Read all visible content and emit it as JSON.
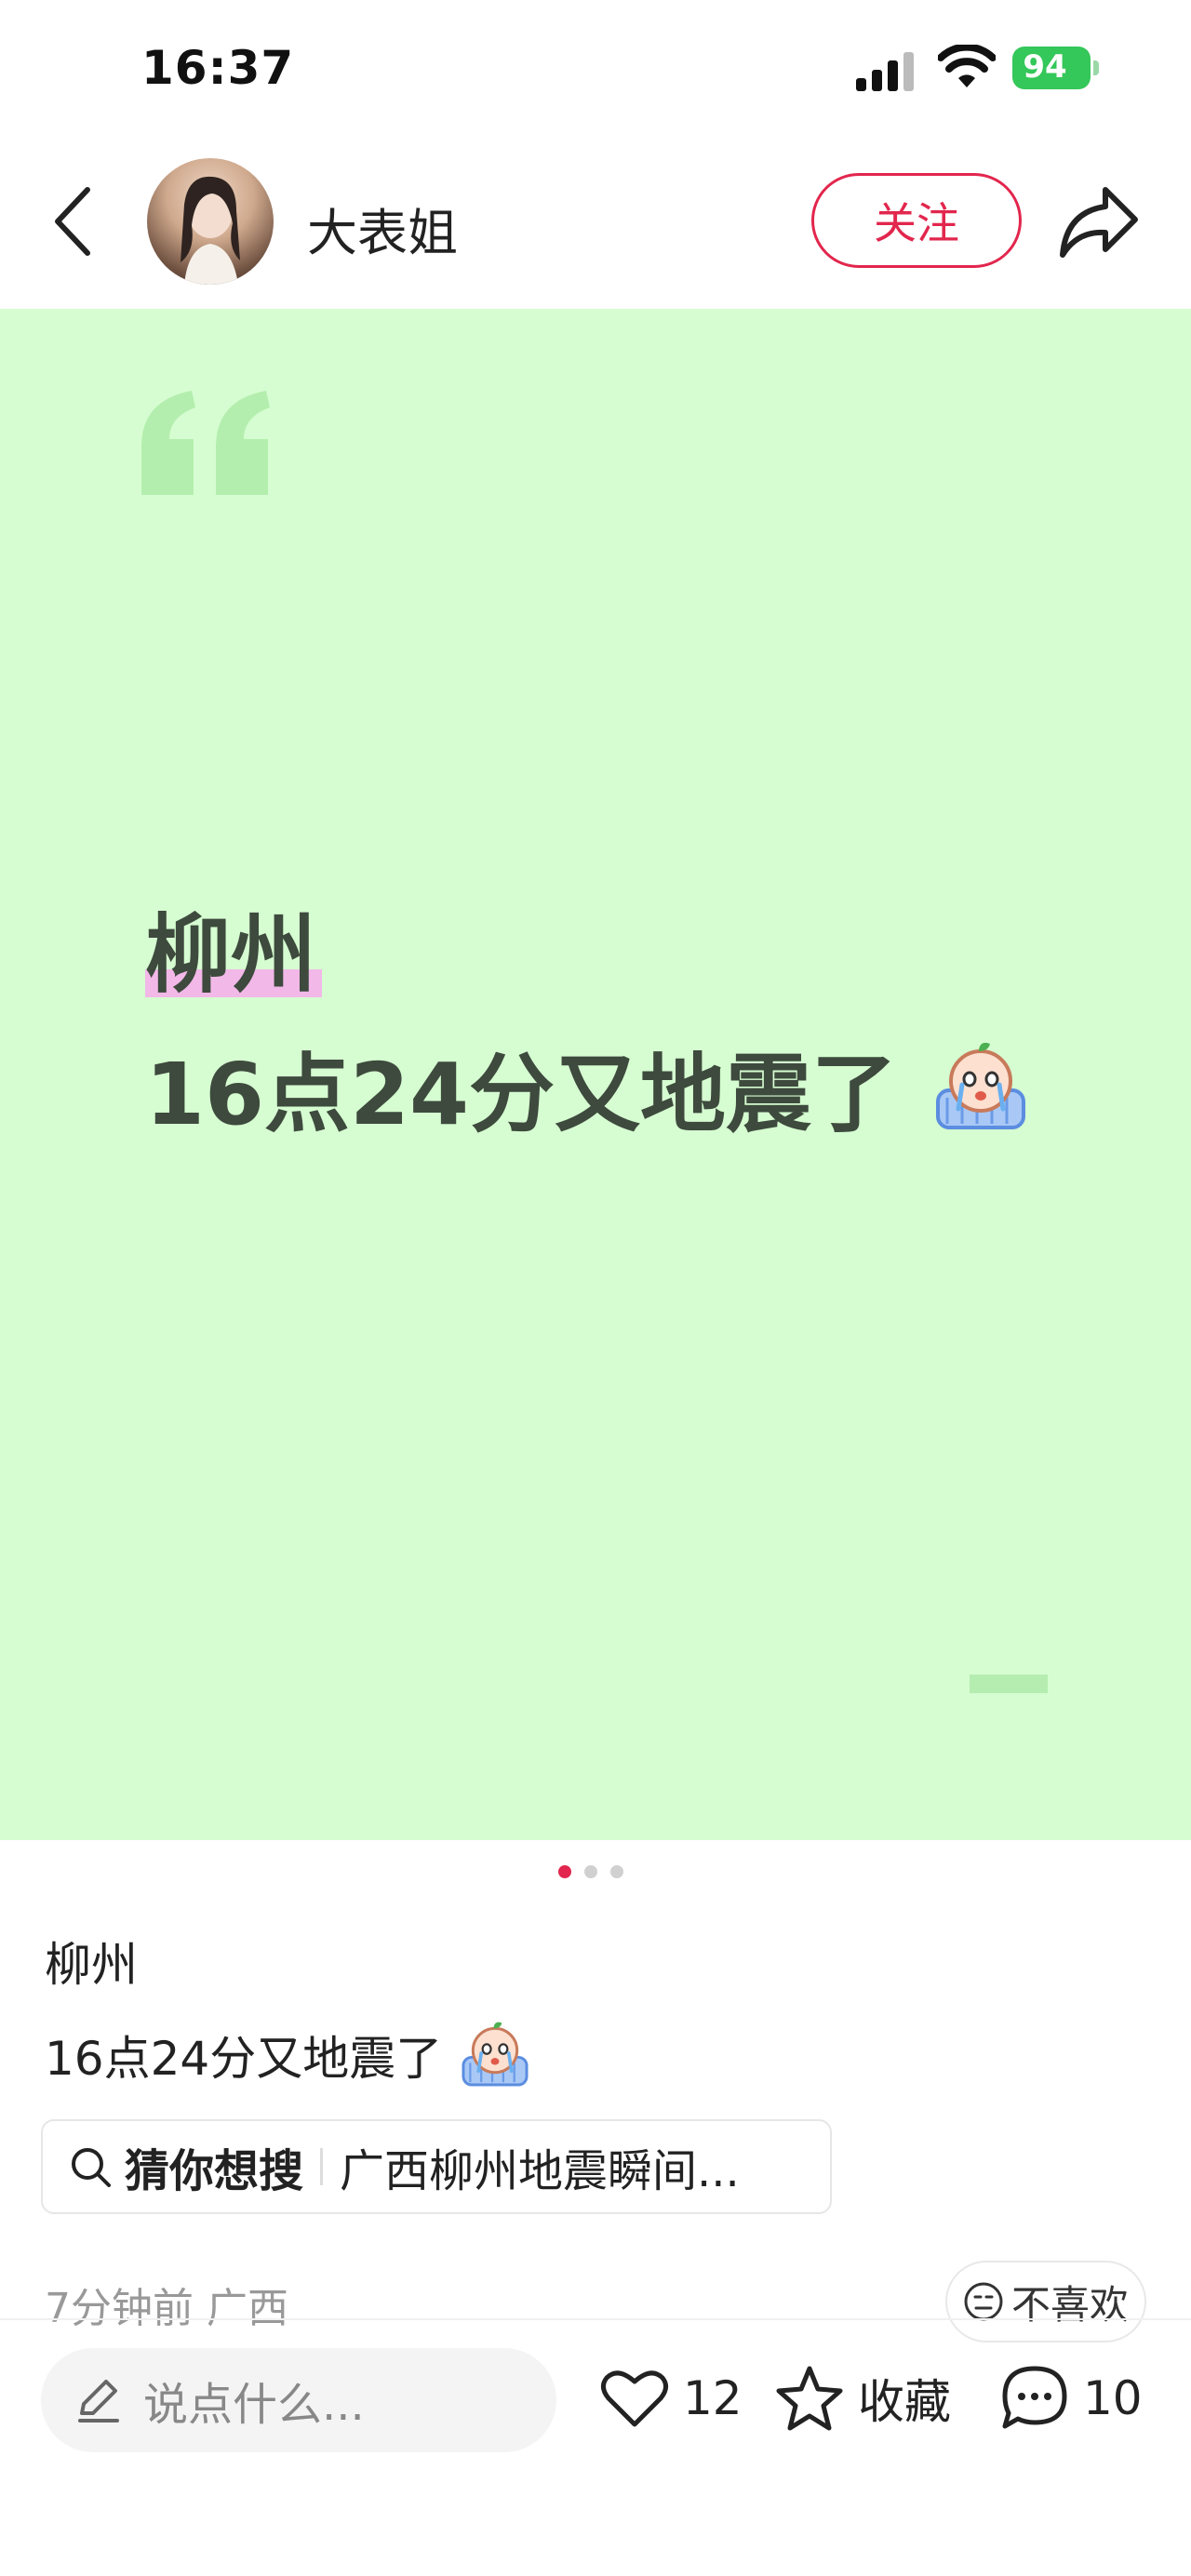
{
  "status_bar": {
    "time": "16:37",
    "battery": "94",
    "icons": [
      "signal-icon",
      "wifi-icon",
      "battery-charging-icon"
    ],
    "battery_color": "#34c759"
  },
  "header": {
    "username": "大表姐",
    "follow_label": "关注",
    "accent_color": "#e2264d",
    "icons": [
      "back-icon",
      "avatar",
      "share-icon"
    ]
  },
  "card": {
    "background": "#d6fdd1",
    "title": "柳州",
    "line2": "16点24分又地震了",
    "emoji": "crying-face-emoji",
    "pagination": {
      "count": 3,
      "active": 0
    }
  },
  "post": {
    "line1": "柳州",
    "line2": "16点24分又地震了",
    "search": {
      "label": "猜你想搜",
      "suggestion": "广西柳州地震瞬间..."
    },
    "meta": "7分钟前 广西",
    "dislike_label": "不喜欢"
  },
  "bottom_bar": {
    "comment_placeholder": "说点什么...",
    "likes": "12",
    "collect_label": "收藏",
    "comments": "10"
  }
}
